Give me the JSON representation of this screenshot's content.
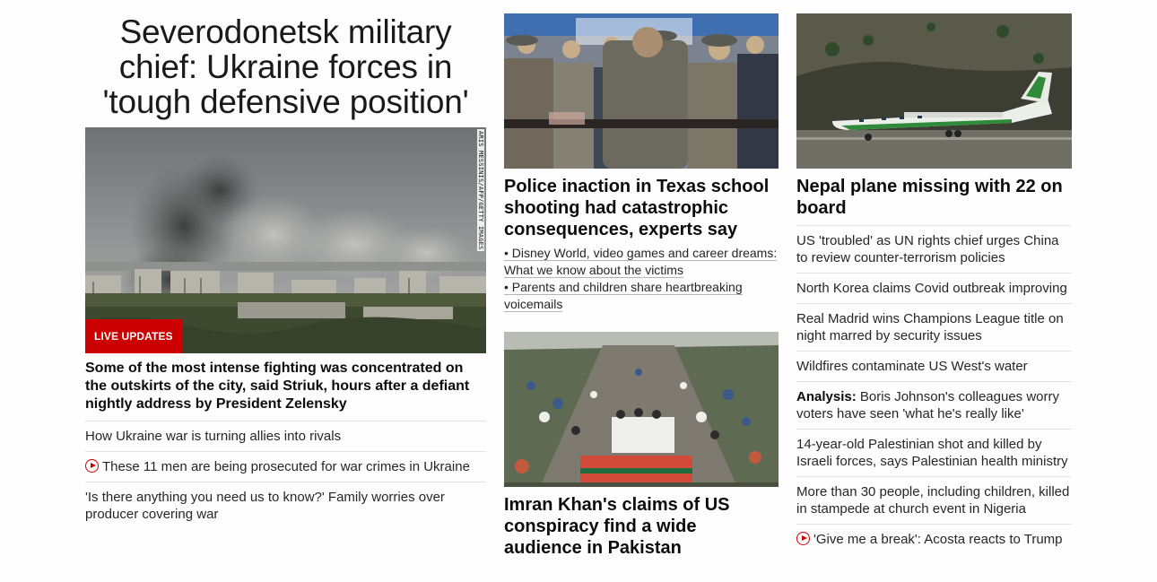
{
  "lead": {
    "headline": "Severodonetsk military chief: Ukraine forces in 'tough defensive position'",
    "image_credit": "ARIS MESSINIS/AFP/GETTY IMAGES",
    "badge": "LIVE UPDATES",
    "summary": "Some of the most intense fighting was concentrated on the outskirts of the city, said Striuk, hours after a defiant nightly address by President Zelensky",
    "related": [
      {
        "text": "How Ukraine war is turning allies into rivals",
        "video": false
      },
      {
        "text": "These 11 men are being prosecuted for war crimes in Ukraine",
        "video": true
      },
      {
        "text": "'Is there anything you need us to know?' Family worries over producer covering war",
        "video": false
      }
    ]
  },
  "middle": {
    "story1": {
      "headline": "Police inaction in Texas school shooting had catastrophic consequences, experts say",
      "bullets": [
        "Disney World, video games and career dreams: What we know about the victims",
        "Parents and children share heartbreaking voicemails"
      ],
      "bullet_char": "•"
    },
    "story2": {
      "headline": "Imran Khan's claims of US conspiracy find a wide audience in Pakistan"
    }
  },
  "right": {
    "headline": "Nepal plane missing with 22 on board",
    "items": [
      {
        "prefix": "",
        "text": "US 'troubled' as UN rights chief urges China to review counter-terrorism policies",
        "video": false
      },
      {
        "prefix": "",
        "text": "North Korea claims Covid outbreak improving",
        "video": false
      },
      {
        "prefix": "",
        "text": "Real Madrid wins Champions League title on night marred by security issues",
        "video": false
      },
      {
        "prefix": "",
        "text": "Wildfires contaminate US West's water",
        "video": false
      },
      {
        "prefix": "Analysis:",
        "text": " Boris Johnson's colleagues worry voters have seen 'what he's really like'",
        "video": false
      },
      {
        "prefix": "",
        "text": "14-year-old Palestinian shot and killed by Israeli forces, says Palestinian health ministry",
        "video": false
      },
      {
        "prefix": "",
        "text": "More than 30 people, including children, killed in stampede at church event in Nigeria",
        "video": false
      },
      {
        "prefix": "",
        "text": "'Give me a break': Acosta reacts to Trump",
        "video": true
      }
    ]
  },
  "colors": {
    "accent": "#cc0000",
    "text": "#0c0c0c",
    "divider": "#e4e4e4"
  }
}
